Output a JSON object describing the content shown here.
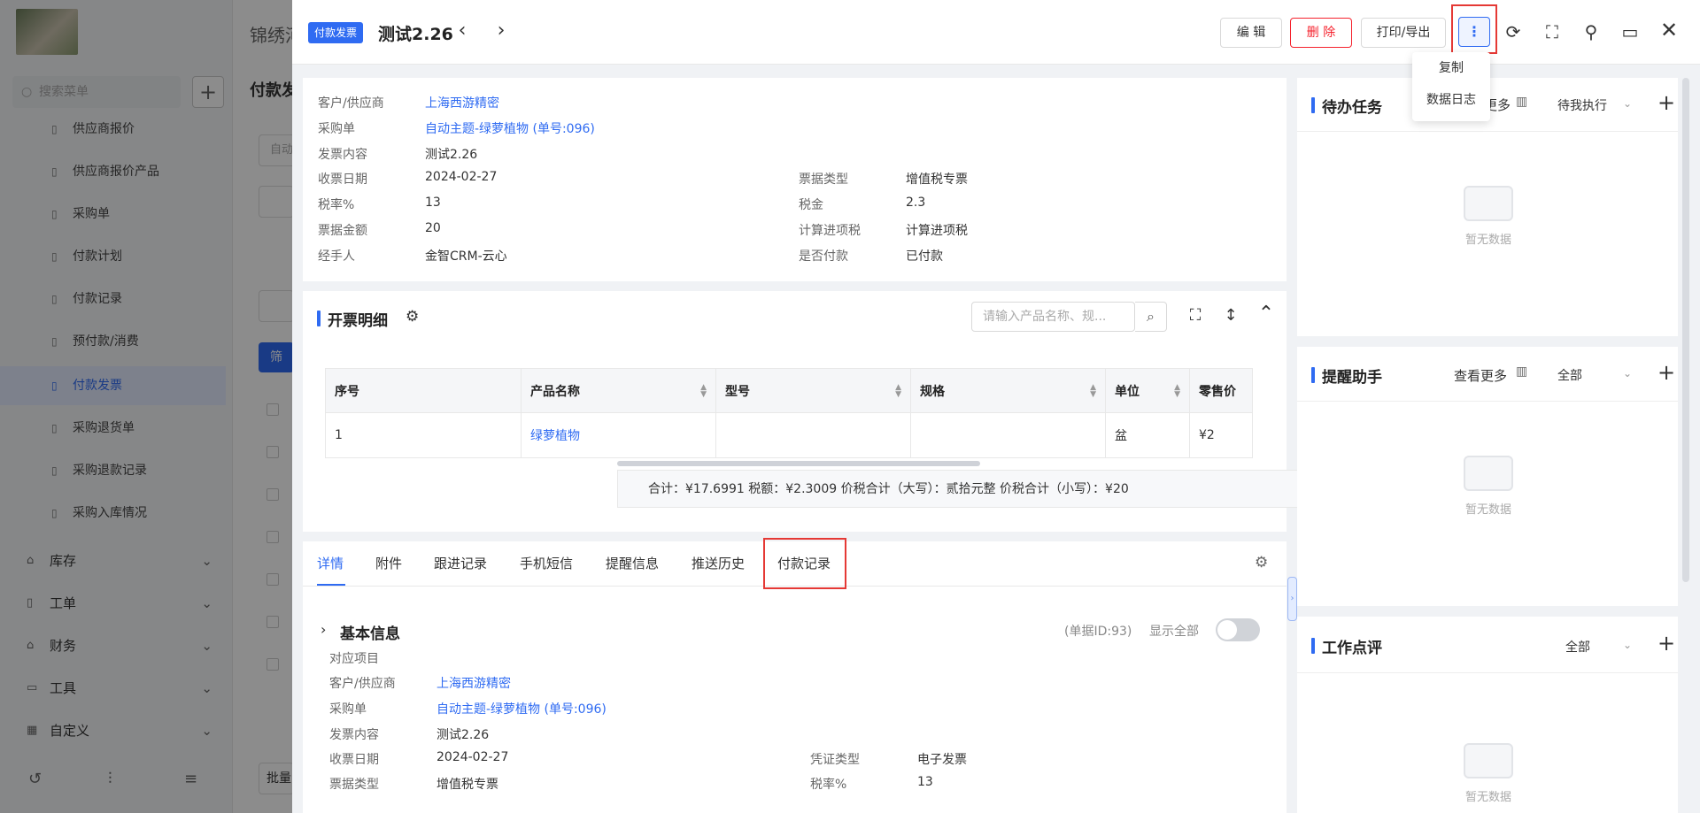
{
  "background": {
    "company": "锦绣河",
    "search_placeholder": "搜索菜单",
    "main_title": "付款发",
    "main_input_hint": "自动",
    "filter_button": "筛",
    "bottom_button": "批量",
    "menu_items": [
      {
        "label": "供应商报价",
        "icon": "document-icon"
      },
      {
        "label": "供应商报价产品",
        "icon": "document-icon"
      },
      {
        "label": "采购单",
        "icon": "cart-icon"
      },
      {
        "label": "付款计划",
        "icon": "document-icon"
      },
      {
        "label": "付款记录",
        "icon": "document-icon"
      },
      {
        "label": "预付款/消费",
        "icon": "document-icon"
      },
      {
        "label": "付款发票",
        "icon": "invoice-icon",
        "active": true
      },
      {
        "label": "采购退货单",
        "icon": "document-icon"
      },
      {
        "label": "采购退款记录",
        "icon": "document-icon"
      },
      {
        "label": "采购入库情况",
        "icon": "document-icon"
      }
    ],
    "menu_groups": [
      {
        "label": "库存",
        "icon": "warehouse-icon"
      },
      {
        "label": "工单",
        "icon": "document-icon"
      },
      {
        "label": "财务",
        "icon": "finance-icon"
      },
      {
        "label": "工具",
        "icon": "toolbox-icon"
      },
      {
        "label": "自定义",
        "icon": "grid-icon"
      }
    ]
  },
  "header": {
    "badge": "付款发票",
    "title": "测试2.26",
    "edit": "编 辑",
    "delete": "删 除",
    "print": "打印/导出",
    "more_menu": [
      "复制",
      "数据日志"
    ]
  },
  "info": {
    "left": [
      {
        "label": "客户/供应商",
        "value": "上海西游精密",
        "link": true
      },
      {
        "label": "采购单",
        "value": "自动主题-绿萝植物 (单号:096)",
        "link": true
      },
      {
        "label": "发票内容",
        "value": "测试2.26"
      },
      {
        "label": "收票日期",
        "value": "2024-02-27"
      },
      {
        "label": "税率%",
        "value": "13"
      },
      {
        "label": "票据金额",
        "value": "20"
      },
      {
        "label": "经手人",
        "value": "金智CRM-云心"
      }
    ],
    "right": [
      {
        "label": "票据类型",
        "value": "增值税专票"
      },
      {
        "label": "税金",
        "value": "2.3"
      },
      {
        "label": "计算进项税",
        "value": "计算进项税"
      },
      {
        "label": "是否付款",
        "value": "已付款"
      }
    ]
  },
  "detail": {
    "title": "开票明细",
    "search_placeholder": "请输入产品名称、规...",
    "columns": [
      "序号",
      "产品名称",
      "型号",
      "规格",
      "单位",
      "零售价"
    ],
    "rows": [
      [
        "1",
        "绿萝植物",
        "",
        "",
        "盆",
        "¥2"
      ]
    ],
    "summary": "合计：¥17.6991   税额：¥2.3009   价税合计（大写）：贰拾元整   价税合计（小写）：¥20"
  },
  "tabs": [
    "详情",
    "附件",
    "跟进记录",
    "手机短信",
    "提醒信息",
    "推送历史",
    "付款记录"
  ],
  "basic": {
    "title": "基本信息",
    "doc_id": "(单据ID:93)",
    "show_all": "显示全部",
    "left": [
      {
        "label": "对应项目",
        "value": ""
      },
      {
        "label": "客户/供应商",
        "value": "上海西游精密",
        "link": true
      },
      {
        "label": "采购单",
        "value": "自动主题-绿萝植物 (单号:096)",
        "link": true
      },
      {
        "label": "发票内容",
        "value": "测试2.26"
      },
      {
        "label": "收票日期",
        "value": "2024-02-27"
      },
      {
        "label": "票据类型",
        "value": "增值税专票"
      }
    ],
    "right": [
      {
        "label": "凭证类型",
        "value": "电子发票"
      },
      {
        "label": "税率%",
        "value": "13"
      }
    ]
  },
  "panels": [
    {
      "title": "待办任务",
      "more": "更多",
      "filter": "待我执行",
      "empty": "暂无数据"
    },
    {
      "title": "提醒助手",
      "more": "查看更多",
      "filter": "全部",
      "empty": "暂无数据"
    },
    {
      "title": "工作点评",
      "more": "",
      "filter": "全部",
      "empty": "暂无数据"
    }
  ],
  "colors": {
    "accent": "#2f6bf2",
    "danger": "#f5222d",
    "highlight": "#e53935"
  }
}
